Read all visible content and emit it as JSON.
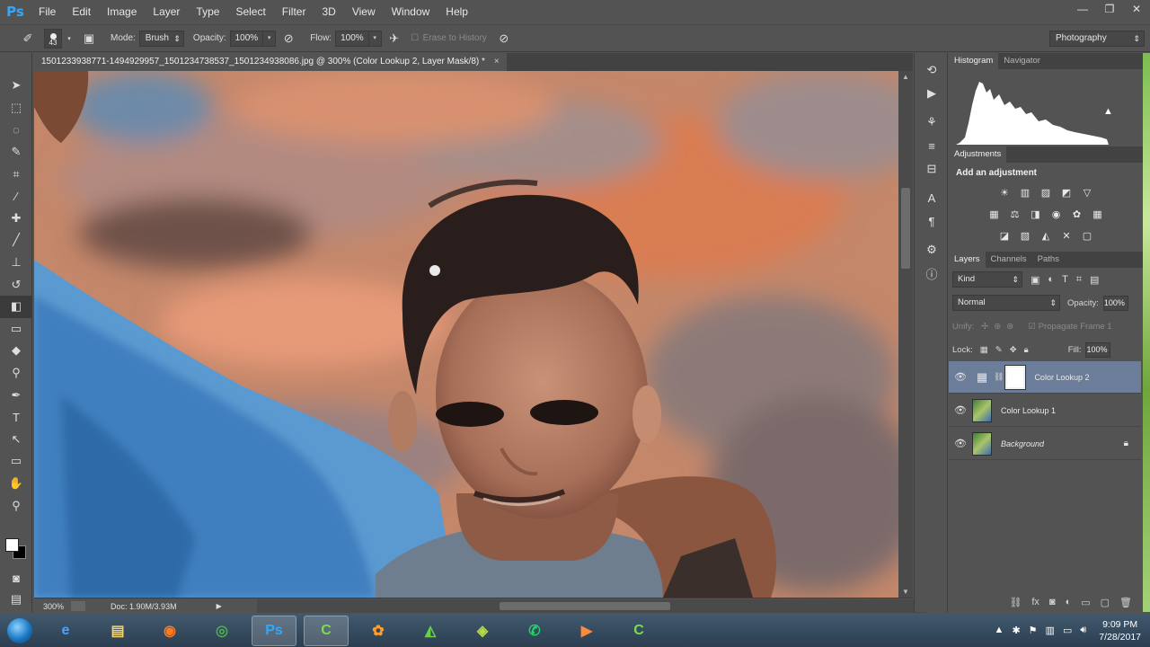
{
  "app": {
    "logo": "Ps"
  },
  "menu": [
    "File",
    "Edit",
    "Image",
    "Layer",
    "Type",
    "Select",
    "Filter",
    "3D",
    "View",
    "Window",
    "Help"
  ],
  "window_controls": [
    "—",
    "❐",
    "✕"
  ],
  "options": {
    "brush_size": "43",
    "mode_label": "Mode:",
    "mode_value": "Brush",
    "opacity_label": "Opacity:",
    "opacity_value": "100%",
    "flow_label": "Flow:",
    "flow_value": "100%",
    "erase_history": "Erase to History",
    "workspace": "Photography"
  },
  "document": {
    "tab_title": "1501233938771-1494929957_1501234738537_1501234938086.jpg @ 300% (Color Lookup 2, Layer Mask/8) *",
    "tab_close": "×"
  },
  "status": {
    "zoom": "300%",
    "doc": "Doc: 1.90M/3.93M"
  },
  "panels": {
    "top_tabs": [
      "Histogram",
      "Navigator"
    ],
    "adjustments_tab": "Adjustments",
    "add_adjustment": "Add an adjustment",
    "layers_tabs": [
      "Layers",
      "Channels",
      "Paths"
    ],
    "kind": "Kind",
    "blend_mode": "Normal",
    "opacity_label": "Opacity:",
    "opacity_value": "100%",
    "unify_label": "Unify:",
    "propagate": "Propagate Frame 1",
    "lock_label": "Lock:",
    "fill_label": "Fill:",
    "fill_value": "100%"
  },
  "layers": [
    {
      "name": "Color Lookup 2",
      "selected": true
    },
    {
      "name": "Color Lookup 1",
      "selected": false
    },
    {
      "name": "Background",
      "selected": false,
      "italic": true
    }
  ],
  "taskbar": {
    "time": "9:09 PM",
    "date": "7/28/2017"
  }
}
